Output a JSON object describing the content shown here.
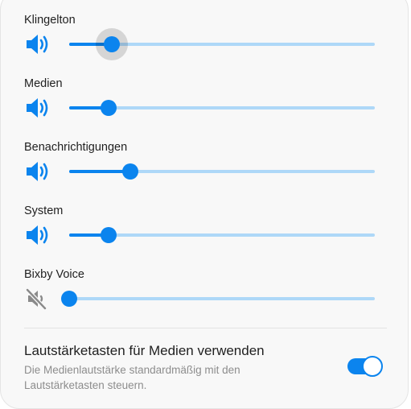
{
  "colors": {
    "accent": "#0b84ee",
    "track": "#aed8f8",
    "muted_icon": "#8a8a8a",
    "text": "#1f1f1f",
    "secondary_text": "#8d8d8d"
  },
  "volume_sliders": [
    {
      "label": "Klingelton",
      "icon": "speaker-icon",
      "level": 0.14,
      "active": true
    },
    {
      "label": "Medien",
      "icon": "speaker-icon",
      "level": 0.13,
      "active": false
    },
    {
      "label": "Benachrichtigungen",
      "icon": "speaker-icon",
      "level": 0.2,
      "active": false
    },
    {
      "label": "System",
      "icon": "speaker-icon",
      "level": 0.13,
      "active": false
    },
    {
      "label": "Bixby Voice",
      "icon": "speaker-muted-icon",
      "level": 0.0,
      "active": false
    }
  ],
  "media_keys_setting": {
    "title": "Lautstärketasten für Medien verwenden",
    "description": "Die Medienlautstärke standardmäßig mit den Lautstärketasten steuern.",
    "enabled": true
  }
}
